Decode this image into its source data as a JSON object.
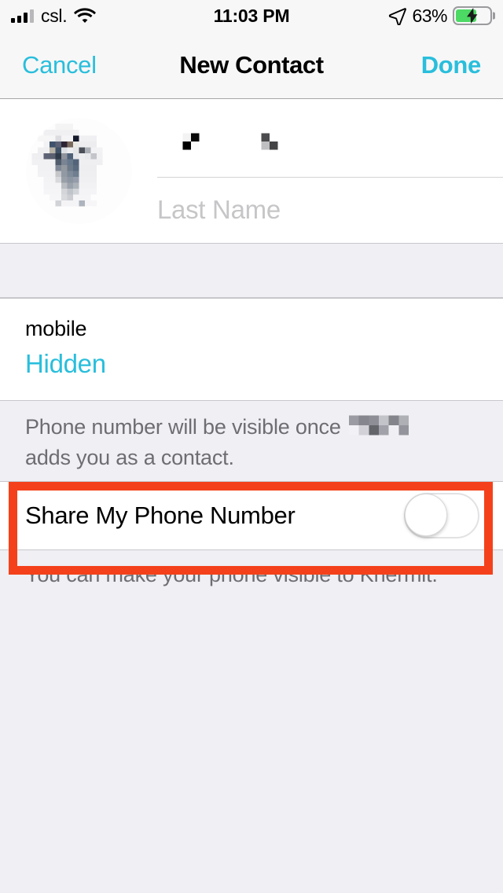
{
  "status_bar": {
    "carrier": "csl.",
    "time": "11:03 PM",
    "battery_percent": "63%",
    "battery_level": 63,
    "charging": true,
    "signal_bars_filled": 3,
    "signal_bars_total": 4,
    "wifi": "wifi-icon",
    "location_arrow": "location-arrow-icon"
  },
  "nav_bar": {
    "cancel_label": "Cancel",
    "title": "New Contact",
    "done_label": "Done"
  },
  "name_section": {
    "avatar": "contact-photo-redacted",
    "first_name_value": "",
    "first_name_redacted": true,
    "last_name_placeholder": "Last Name",
    "last_name_value": ""
  },
  "phone_section": {
    "label": "mobile",
    "value": "Hidden",
    "footer_note_before": "Phone number will be visible once",
    "footer_note_after": "adds you as a contact.",
    "footer_note_redacted_name": true
  },
  "share_row": {
    "label": "Share My Phone Number",
    "toggle_on": false,
    "footer_note": "You can make your phone visible to Khermit."
  },
  "annotation": {
    "color": "#F4411B",
    "target": "share-my-phone-number-row"
  },
  "colors": {
    "tint": "#29BEDC",
    "nav_bg": "#F7F7F7",
    "page_bg": "#EFEFF4",
    "card_bg": "#FFFFFF",
    "secondary_text": "#6D6D72",
    "placeholder_text": "#C6C6C8",
    "battery_green": "#4CD964",
    "annotation_red": "#F4411B"
  }
}
